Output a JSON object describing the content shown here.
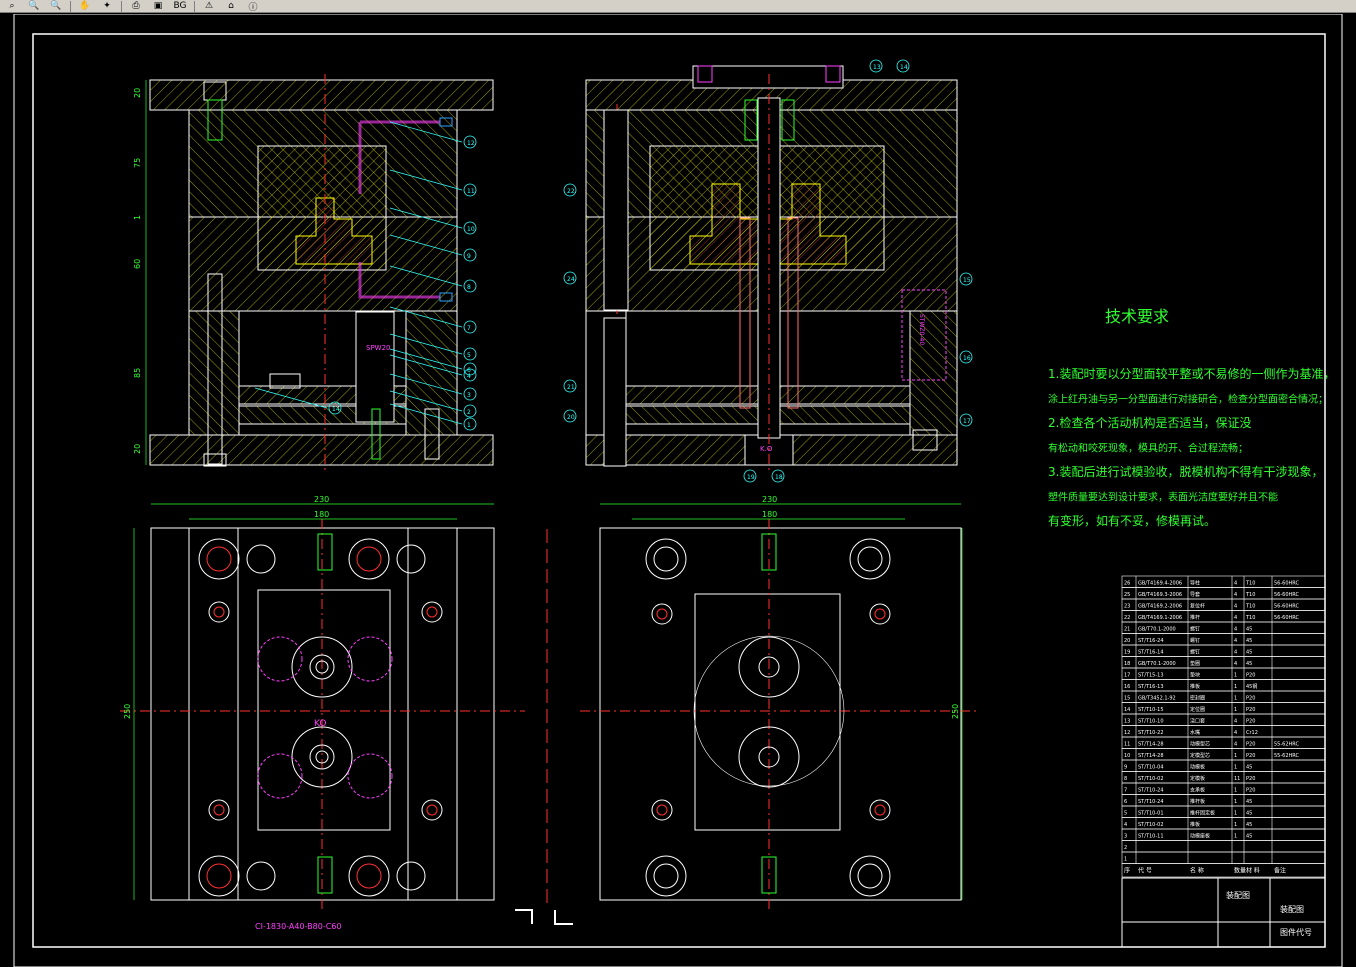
{
  "toolbar": {
    "buttons": [
      {
        "icon": "zoom-window-icon",
        "glyph": "⌕"
      },
      {
        "icon": "zoom-out-icon",
        "glyph": "🔍"
      },
      {
        "icon": "zoom-extents-icon",
        "glyph": "🔍"
      },
      {
        "icon": "pan-icon",
        "glyph": "✋"
      },
      {
        "icon": "layer-icon",
        "glyph": "✦"
      },
      {
        "icon": "print-icon",
        "glyph": "⎙"
      },
      {
        "icon": "copy-icon",
        "glyph": "▣"
      },
      {
        "icon": "background-color-label",
        "glyph": "BG"
      },
      {
        "icon": "properties-icon",
        "glyph": "⚠"
      },
      {
        "icon": "home-icon",
        "glyph": "⌂"
      },
      {
        "icon": "info-icon",
        "glyph": "ⓘ"
      }
    ]
  },
  "drawing": {
    "tech_title": "技术要求",
    "tech_lines": [
      "1.装配时要以分型面较平整或不易修的一侧作为基准，",
      "涂上红丹油与另一分型面进行对接研合，检查分型面密合情况；",
      "2.检查各个活动机构是否适当，保证没",
      "有松动和咬死现象，模具的开、合过程流畅；",
      "3.装配后进行试模验收，脱模机构不得有干涉现象，",
      "塑件质量要达到设计要求，表面光洁度要好并且不能",
      "有变形，如有不妥，修模再试。"
    ],
    "mold_base_code": "CI-1830-A40-B80-C60",
    "dims": {
      "width_230": "230",
      "width_180": "180",
      "height_250": "250",
      "plate_20a": "20",
      "plate_75": "75",
      "plate_1": "1",
      "plate_60": "60",
      "plate_85": "85",
      "plate_20b": "20"
    },
    "labels": {
      "spw": "SPW20",
      "ko": "KO",
      "ko2": "K.O",
      "pin_text": "STWZ0-40"
    },
    "balloons_left": [
      "12",
      "11",
      "10",
      "9",
      "8",
      "7",
      "6",
      "5",
      "4",
      "3",
      "2",
      "1",
      "14"
    ],
    "balloons_right": [
      "13",
      "14",
      "22",
      "24",
      "21",
      "20",
      "15",
      "16",
      "17",
      "19",
      "18"
    ],
    "title_block": {
      "name1": "装配图",
      "name2": "装配图",
      "drawing_no": "图件代号"
    },
    "bom_rows": [
      [
        "26",
        "GB/T4169.4-2006",
        "导柱",
        "4",
        "T10",
        "56-60HRC"
      ],
      [
        "25",
        "GB/T4169.3-2006",
        "导套",
        "4",
        "T10",
        "56-60HRC"
      ],
      [
        "23",
        "GB/T4169.2-2006",
        "复位杆",
        "4",
        "T10",
        "56-60HRC"
      ],
      [
        "22",
        "GB/T4169.1-2006",
        "推杆",
        "4",
        "T10",
        "56-60HRC"
      ],
      [
        "21",
        "GB/T70.1-2000",
        "螺钉",
        "4",
        "45",
        ""
      ],
      [
        "20",
        "ST/T16-24",
        "螺钉",
        "4",
        "45",
        ""
      ],
      [
        "19",
        "ST/T16-14",
        "螺钉",
        "4",
        "45",
        ""
      ],
      [
        "18",
        "GB/T70.1-2000",
        "垫圈",
        "4",
        "45",
        ""
      ],
      [
        "17",
        "ST/T15-13",
        "垫块",
        "1",
        "P20",
        ""
      ],
      [
        "16",
        "ST/T16-13",
        "推板",
        "1",
        "45钢",
        ""
      ],
      [
        "15",
        "GB/T3452.1-92",
        "密封圈",
        "1",
        "P20",
        ""
      ],
      [
        "14",
        "ST/T10-15",
        "定位圈",
        "1",
        "P20",
        ""
      ],
      [
        "13",
        "ST/T10-10",
        "浇口套",
        "4",
        "P20",
        ""
      ],
      [
        "12",
        "ST/T10-22",
        "水嘴",
        "4",
        "Cr12",
        ""
      ],
      [
        "11",
        "ST/T14-28",
        "动模型芯",
        "4",
        "P20",
        "55-62HRC"
      ],
      [
        "10",
        "ST/T14-28",
        "定模型芯",
        "1",
        "P20",
        "55-62HRC"
      ],
      [
        "9",
        "ST/T10-04",
        "动模板",
        "1",
        "45",
        ""
      ],
      [
        "8",
        "ST/T10-02",
        "定模板",
        "11",
        "P20",
        ""
      ],
      [
        "7",
        "ST/T10-24",
        "支承板",
        "1",
        "P20",
        ""
      ],
      [
        "6",
        "ST/T10-24",
        "推杆板",
        "1",
        "45",
        ""
      ],
      [
        "5",
        "ST/T10-01",
        "推杆固定板",
        "1",
        "45",
        ""
      ],
      [
        "4",
        "ST/T10-02",
        "推板",
        "1",
        "45",
        ""
      ],
      [
        "3",
        "ST/T10-11",
        "动模座板",
        "1",
        "45",
        ""
      ],
      [
        "2",
        "",
        "",
        "",
        "",
        ""
      ],
      [
        "1",
        "",
        "",
        "",
        "",
        ""
      ]
    ],
    "bom_header": [
      "序",
      "代 号",
      "名 称",
      "数量",
      "材 料",
      "备注"
    ]
  }
}
